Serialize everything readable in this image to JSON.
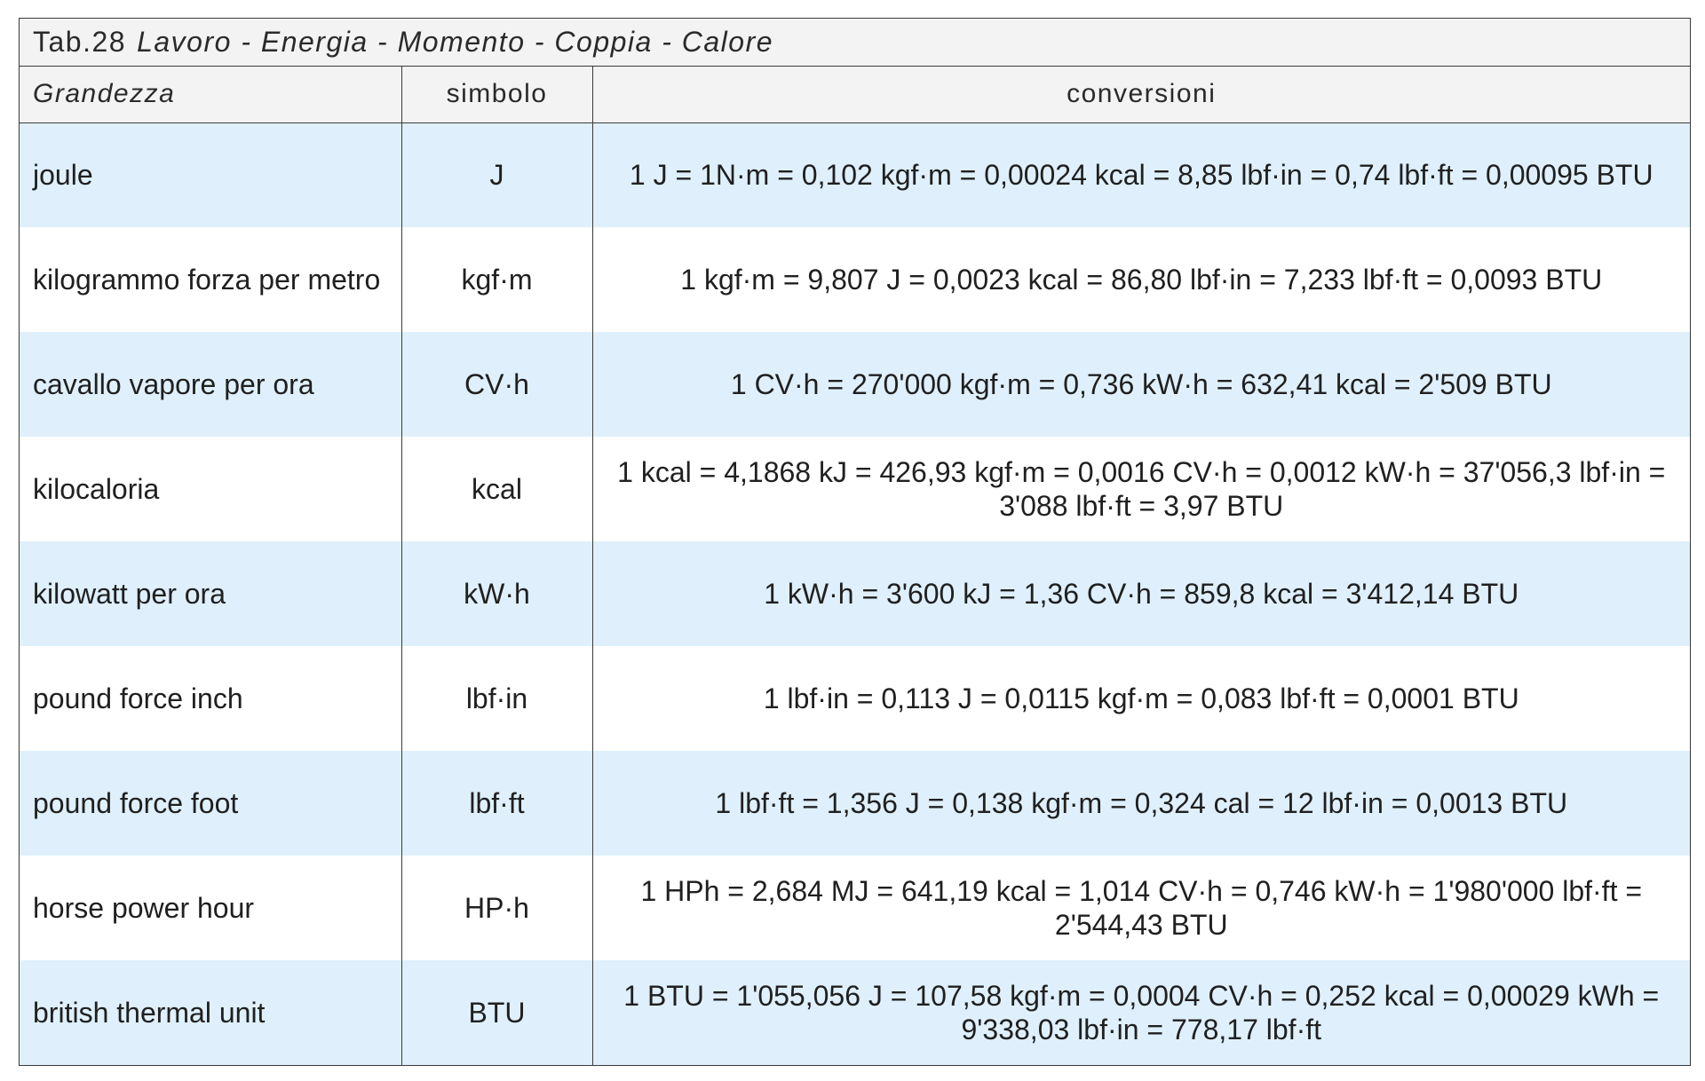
{
  "table": {
    "title_code": "Tab.28",
    "title_text": "Lavoro - Energia - Momento - Coppia - Calore",
    "headers": {
      "grandezza": "Grandezza",
      "simbolo": "simbolo",
      "conversioni": "conversioni"
    },
    "rows": [
      {
        "name": "joule",
        "symbol": "J",
        "conversion": "1 J = 1N·m = 0,102 kgf·m = 0,00024 kcal = 8,85 lbf·in = 0,74 lbf·ft = 0,00095 BTU"
      },
      {
        "name": "kilogrammo forza per metro",
        "symbol": "kgf·m",
        "conversion": "1 kgf·m = 9,807 J = 0,0023 kcal = 86,80 lbf·in = 7,233 lbf·ft = 0,0093 BTU"
      },
      {
        "name": "cavallo vapore per ora",
        "symbol": "CV·h",
        "conversion": "1 CV·h = 270'000 kgf·m = 0,736 kW·h = 632,41 kcal = 2'509 BTU"
      },
      {
        "name": "kilocaloria",
        "symbol": "kcal",
        "conversion": "1 kcal = 4,1868 kJ = 426,93 kgf·m = 0,0016 CV·h = 0,0012 kW·h = 37'056,3 lbf·in = 3'088 lbf·ft = 3,97 BTU"
      },
      {
        "name": "kilowatt per ora",
        "symbol": "kW·h",
        "conversion": "1 kW·h = 3'600 kJ = 1,36 CV·h = 859,8 kcal = 3'412,14 BTU"
      },
      {
        "name": "pound force inch",
        "symbol": "lbf·in",
        "conversion": "1 lbf·in = 0,113 J = 0,0115 kgf·m = 0,083 lbf·ft = 0,0001 BTU"
      },
      {
        "name": "pound force foot",
        "symbol": "lbf·ft",
        "conversion": "1 lbf·ft = 1,356 J = 0,138 kgf·m = 0,324 cal = 12 lbf·in = 0,0013 BTU"
      },
      {
        "name": "horse power hour",
        "symbol": "HP·h",
        "conversion": "1 HPh = 2,684 MJ = 641,19 kcal = 1,014 CV·h = 0,746 kW·h = 1'980'000 lbf·ft = 2'544,43 BTU"
      },
      {
        "name": "british thermal unit",
        "symbol": "BTU",
        "conversion": "1 BTU = 1'055,056 J = 107,58 kgf·m = 0,0004 CV·h = 0,252 kcal = 0,00029 kWh = 9'338,03 lbf·in = 778,17 lbf·ft"
      }
    ]
  }
}
